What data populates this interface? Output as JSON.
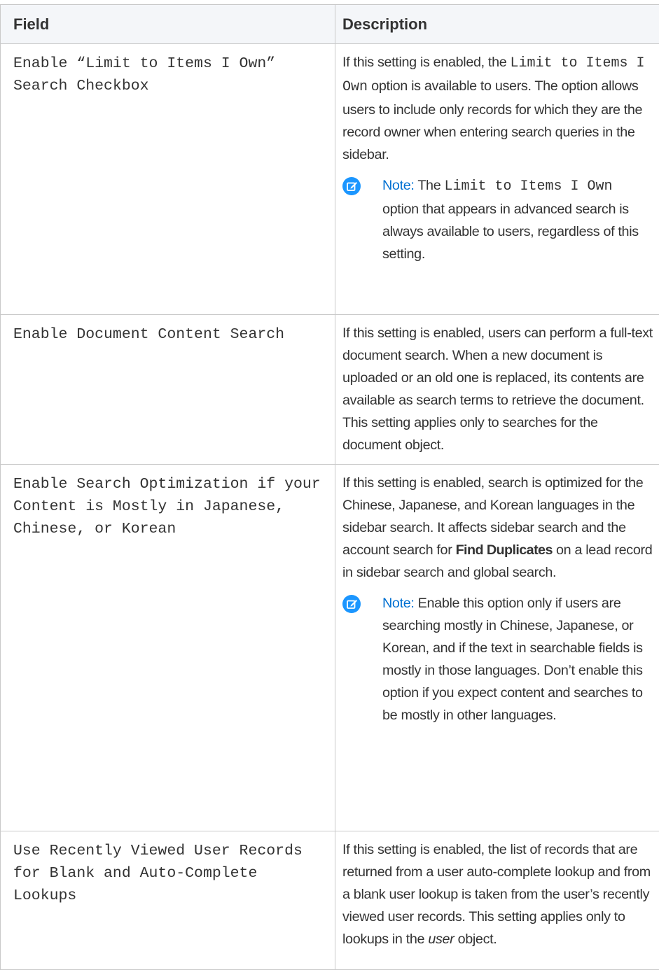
{
  "table": {
    "header": {
      "field": "Field",
      "description": "Description"
    },
    "rows": [
      {
        "field": "Enable “Limit to Items I Own” Search Checkbox",
        "desc_pre": "If this setting is enabled, the ",
        "desc_code": "Limit to Items I Own",
        "desc_post": " option is available to users. The option allows users to include only records for which they are the record owner when entering search queries in the sidebar.",
        "note_label": "Note:",
        "note_pre": " The ",
        "note_code": "Limit to Items I Own",
        "note_post": " option that appears in advanced search is always available to users, regardless of this setting."
      },
      {
        "field": "Enable Document Content Search",
        "desc": "If this setting is enabled, users can perform a full-text document search. When a new document is uploaded or an old one is replaced, its contents are available as search terms to retrieve the document. This setting applies only to searches for the document object."
      },
      {
        "field": "Enable Search Optimization if your Content is Mostly in Japanese, Chinese, or Korean",
        "desc_pre": "If this setting is enabled, search is optimized for the Chinese, Japanese, and Korean languages in the sidebar search. It affects sidebar search and the account search for ",
        "desc_bold": "Find Duplicates",
        "desc_post": " on a lead record in sidebar search and global search.",
        "note_label": "Note:",
        "note_text": "  Enable this option only if users are searching mostly in Chinese, Japanese, or Korean, and if the text in searchable fields is mostly in those languages. Don’t enable this option if you expect content and searches to be mostly in other languages."
      },
      {
        "field": "Use Recently Viewed User Records for Blank and Auto-Complete Lookups",
        "desc_pre": "If this setting is enabled, the list of records that are returned from a user auto-complete lookup and from a blank user lookup is taken from the user’s recently viewed user records. This setting applies only to lookups in the ",
        "desc_italic": "user",
        "desc_post": " object."
      }
    ]
  },
  "colors": {
    "note_accent": "#0070d2",
    "note_icon_bg": "#1b96ff",
    "border": "#c9c9c9"
  },
  "icons": {
    "note": "note-edit-icon"
  }
}
